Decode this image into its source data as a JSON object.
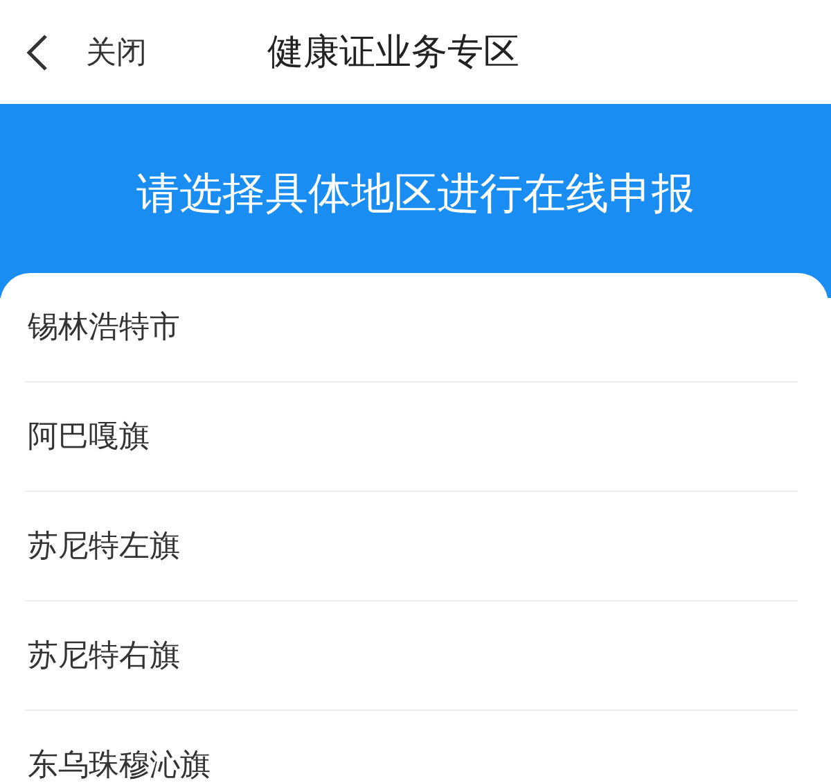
{
  "nav": {
    "close": "关闭",
    "title": "健康证业务专区"
  },
  "banner": {
    "text": "请选择具体地区进行在线申报"
  },
  "regions": [
    "锡林浩特市",
    "阿巴嘎旗",
    "苏尼特左旗",
    "苏尼特右旗",
    "东乌珠穆沁旗"
  ]
}
